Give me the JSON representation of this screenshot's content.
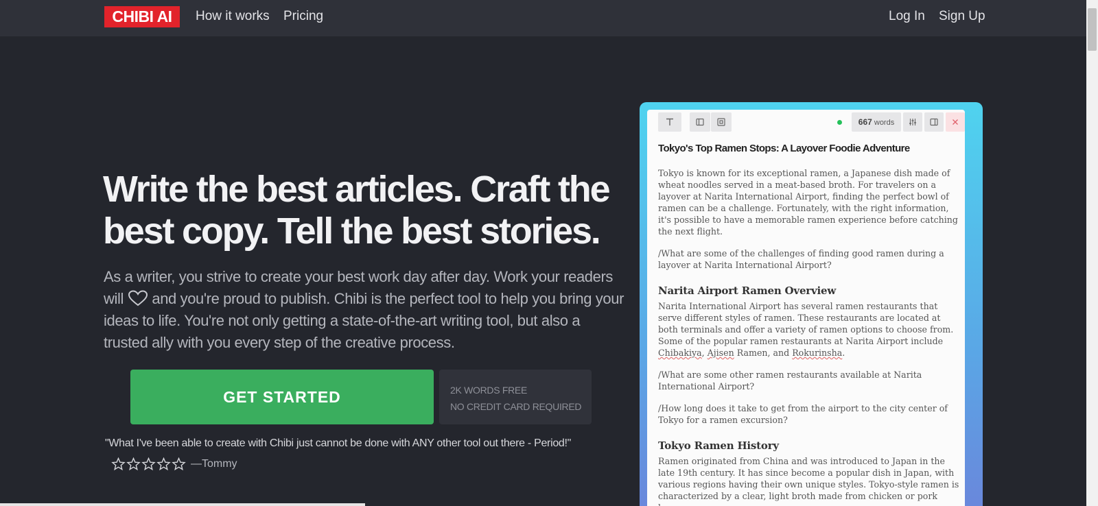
{
  "header": {
    "logo": "CHIBI AI",
    "nav": [
      {
        "label": "How it works"
      },
      {
        "label": "Pricing"
      }
    ],
    "login": "Log In",
    "signup": "Sign Up"
  },
  "hero": {
    "headline_line1": "Write the best articles. Craft the",
    "headline_line2": "best copy. Tell the best stories.",
    "sub_before_heart": "As a writer, you strive to create your best work day after day. Work your readers will",
    "sub_after_heart": " and you're proud to publish. Chibi is the perfect tool to help you bring your ideas to life. You're not only getting a state-of-the-art writing tool, but also a trusted ally with you every step of the creative process.",
    "cta": "GET STARTED",
    "note_line1": "2K WORDS FREE",
    "note_line2": "NO CREDIT CARD REQUIRED",
    "quote": "\"What I've been able to create with Chibi just cannot be done with ANY other tool out there - Period!\"",
    "rating": 0,
    "rating_max": 5,
    "attribution": "—Tommy"
  },
  "editor": {
    "word_count": "667",
    "word_label": "words",
    "title": "Tokyo's Top Ramen Stops: A Layover Foodie Adventure",
    "p1": "Tokyo is known for its exceptional ramen, a Japanese dish made of wheat noodles served in a meat-based broth. For travelers on a layover at Narita International Airport, finding the perfect bowl of ramen can be a challenge. Fortunately, with the right information, it's possible to have a memorable ramen experience before catching the next flight.",
    "q1": "/What are some of the challenges of finding good ramen during a layover at Narita International Airport?",
    "h1": "Narita Airport Ramen Overview",
    "p2_a": "Narita International Airport has several ramen restaurants that serve different styles of ramen. These restaurants are located at both terminals and offer a variety of ramen options to choose from. Some of the popular ramen restaurants at Narita Airport include ",
    "p2_w1": "Chibakiya",
    "p2_sep1": ", ",
    "p2_w2": "Ajisen",
    "p2_b": " Ramen, and ",
    "p2_w3": "Rokurinsha",
    "p2_end": ".",
    "q2": "/What are some other ramen restaurants available at Narita International Airport?",
    "q3": "/How long does it take to get from the airport to the city center of Tokyo for a ramen excursion?",
    "h2": "Tokyo Ramen History",
    "p3": "Ramen originated from China and was introduced to Japan in the late 19th century. It has since become a popular dish in Japan, with various regions having their own unique styles. Tokyo-style ramen is characterized by a clear, light broth made from chicken or pork bones"
  },
  "colors": {
    "background": "#24262d",
    "header": "#2f3139",
    "logo": "#e2232b",
    "cta": "#3aae5e",
    "card_gradient_top": "#4fd3ef",
    "card_gradient_bottom": "#6a86db"
  },
  "icons": [
    "heart-icon",
    "star-icon",
    "text-format-icon",
    "sidebar-icon",
    "focus-icon",
    "sliders-icon",
    "panel-icon",
    "close-icon"
  ]
}
